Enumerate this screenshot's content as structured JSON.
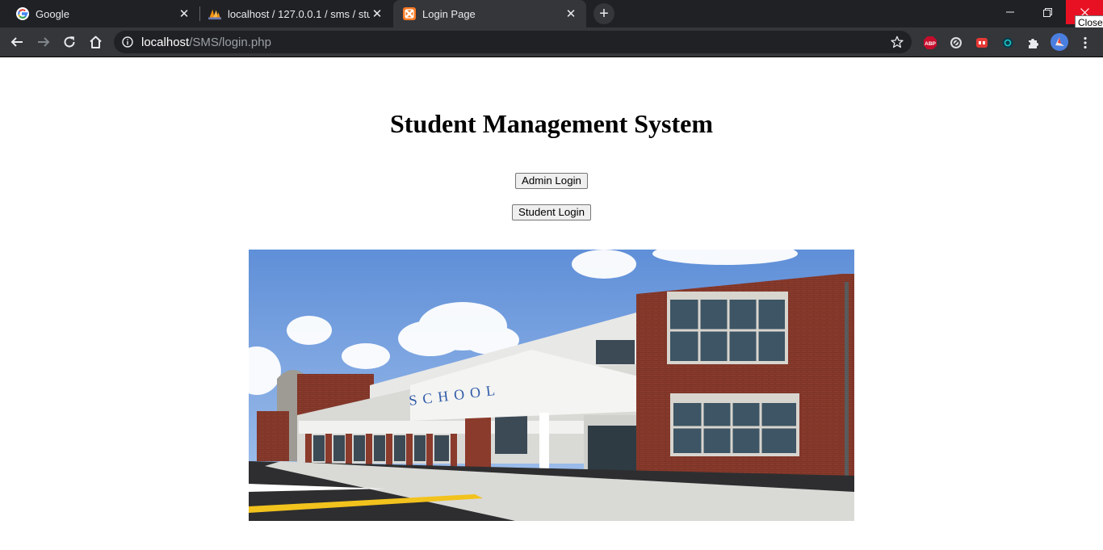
{
  "browser": {
    "tabs": [
      {
        "title": "Google",
        "icon": "google-g-icon"
      },
      {
        "title": "localhost / 127.0.0.1 / sms / stude",
        "icon": "phpmyadmin-icon"
      },
      {
        "title": "Login Page",
        "icon": "xampp-icon",
        "active": true
      }
    ],
    "new_tab_label": "+",
    "close_tooltip": "Close",
    "url_host": "localhost",
    "url_path": "/SMS/login.php",
    "extensions": [
      "adblock-plus-icon",
      "block-site-icon",
      "youtube-ext-icon",
      "circle-ext-icon",
      "puzzle-extensions-icon",
      "profile-avatar-icon",
      "menu-dots-icon"
    ],
    "extension_labels": {
      "abp": "ABP"
    }
  },
  "page": {
    "title": "Student Management System",
    "admin_login": "Admin Login",
    "student_login": "Student Login",
    "image_signage": "SCHOOL"
  },
  "colors": {
    "tabstrip": "#202124",
    "toolbar": "#35363a",
    "close_red": "#e81123"
  }
}
